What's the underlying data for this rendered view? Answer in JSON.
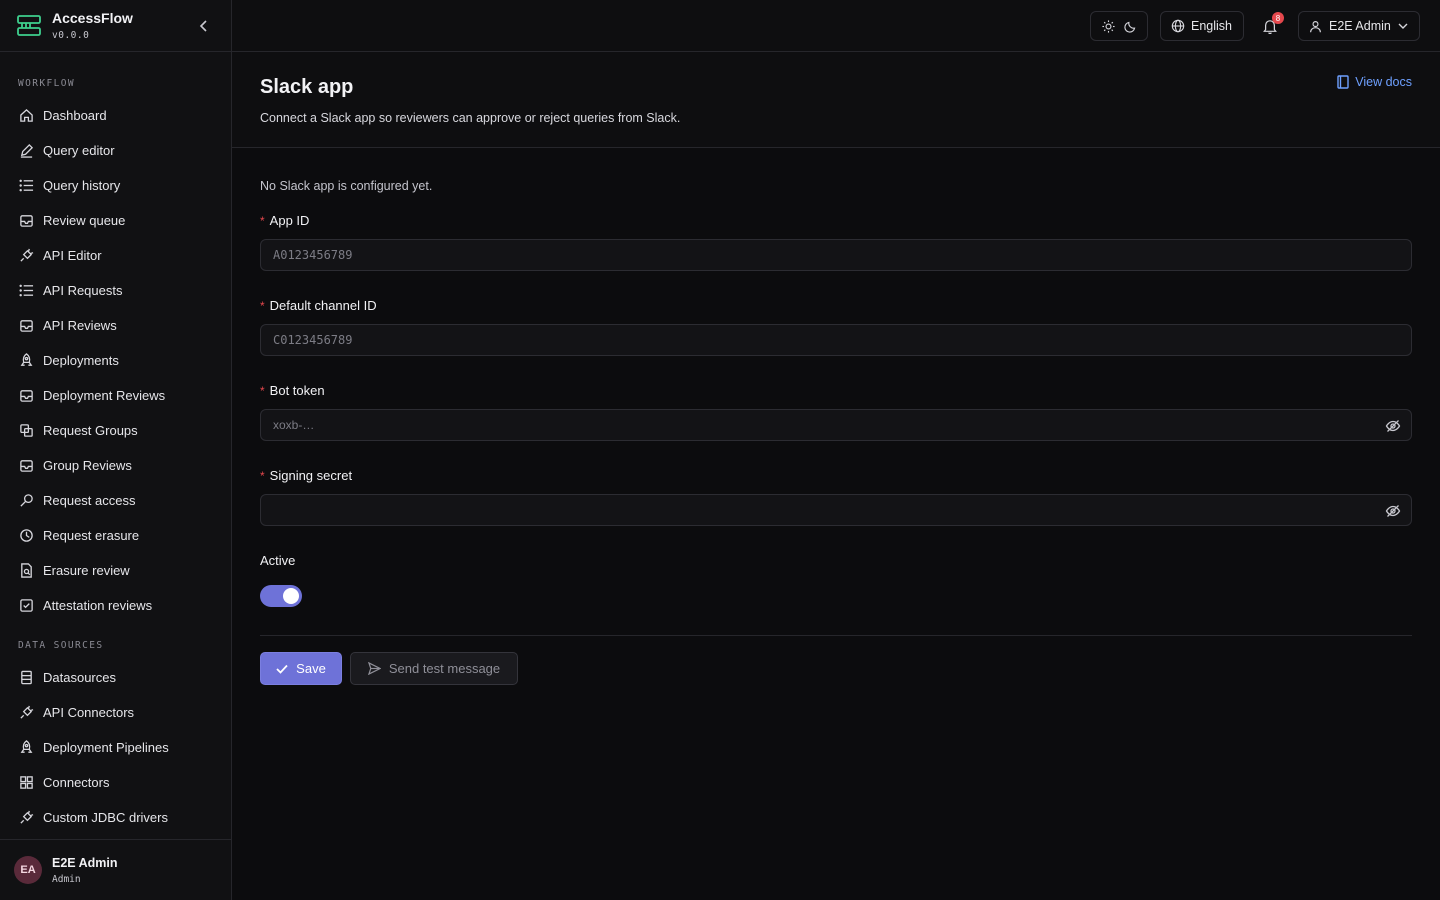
{
  "app": {
    "name": "AccessFlow",
    "version": "v0.0.0"
  },
  "sidebar": {
    "sections": [
      {
        "label": "WORKFLOW"
      },
      {
        "label": "DATA SOURCES"
      }
    ],
    "workflow_items": [
      {
        "label": "Dashboard",
        "icon": "home-icon"
      },
      {
        "label": "Query editor",
        "icon": "pencil-icon"
      },
      {
        "label": "Query history",
        "icon": "list-icon"
      },
      {
        "label": "Review queue",
        "icon": "inbox-icon"
      },
      {
        "label": "API Editor",
        "icon": "plug-icon"
      },
      {
        "label": "API Requests",
        "icon": "list-icon"
      },
      {
        "label": "API Reviews",
        "icon": "inbox-icon"
      },
      {
        "label": "Deployments",
        "icon": "rocket-icon"
      },
      {
        "label": "Deployment Reviews",
        "icon": "inbox-icon"
      },
      {
        "label": "Request Groups",
        "icon": "copy-icon"
      },
      {
        "label": "Group Reviews",
        "icon": "inbox-icon"
      },
      {
        "label": "Request access",
        "icon": "key-icon"
      },
      {
        "label": "Request erasure",
        "icon": "history-icon"
      },
      {
        "label": "Erasure review",
        "icon": "file-search-icon"
      },
      {
        "label": "Attestation reviews",
        "icon": "check-square-icon"
      }
    ],
    "datasource_items": [
      {
        "label": "Datasources",
        "icon": "database-icon"
      },
      {
        "label": "API Connectors",
        "icon": "plug-icon"
      },
      {
        "label": "Deployment Pipelines",
        "icon": "rocket-icon"
      },
      {
        "label": "Connectors",
        "icon": "grid-icon"
      },
      {
        "label": "Custom JDBC drivers",
        "icon": "plug-icon"
      }
    ],
    "user": {
      "initials": "EA",
      "name": "E2E Admin",
      "role": "Admin"
    }
  },
  "topbar": {
    "language": "English",
    "notifications_count": "8",
    "user_name": "E2E Admin"
  },
  "page": {
    "title": "Slack app",
    "description": "Connect a Slack app so reviewers can approve or reject queries from Slack.",
    "docs_link": "View docs"
  },
  "form": {
    "status": "No Slack app is configured yet.",
    "required_marker": "*",
    "fields": [
      {
        "label": "App ID",
        "placeholder": "A0123456789"
      },
      {
        "label": "Default channel ID",
        "placeholder": "C0123456789"
      },
      {
        "label": "Bot token",
        "placeholder": "xoxb-…"
      },
      {
        "label": "Signing secret",
        "placeholder": ""
      }
    ],
    "active_label": "Active",
    "active": true,
    "save_label": "Save",
    "test_label": "Send test message"
  },
  "colors": {
    "accent": "#6e72d8",
    "link": "#6ea0ff",
    "danger": "#e5484d",
    "background": "#0c0c0e"
  }
}
